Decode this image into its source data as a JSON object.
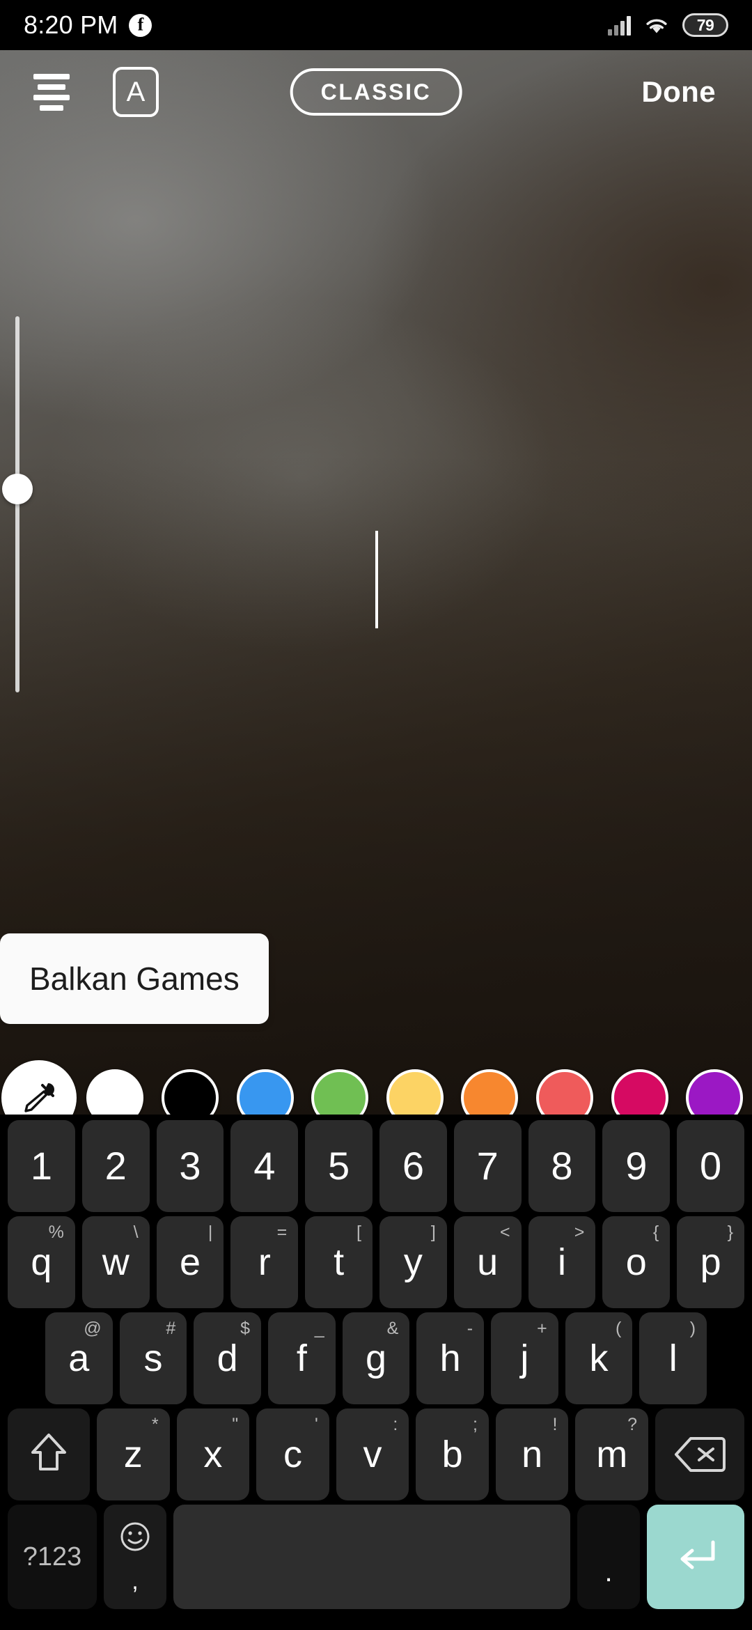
{
  "status_bar": {
    "time": "8:20 PM",
    "app_icon": "facebook-icon",
    "battery_level": "79",
    "signal_icon": "cellular-signal-icon",
    "wifi_icon": "wifi-icon"
  },
  "toolbar": {
    "align_icon": "text-align-center-icon",
    "text_background_label": "A",
    "font_style_label": "CLASSIC",
    "done_label": "Done"
  },
  "editor": {
    "text_value": "Balkan Games",
    "caret": "text-caret",
    "size_slider": "text-size-slider"
  },
  "palette": {
    "swatches": [
      {
        "name": "eyedropper",
        "color": "#ffffff"
      },
      {
        "name": "white",
        "color": "#ffffff"
      },
      {
        "name": "black",
        "color": "#000000"
      },
      {
        "name": "blue",
        "color": "#3897f0"
      },
      {
        "name": "green",
        "color": "#70bf53"
      },
      {
        "name": "yellow",
        "color": "#fcd364"
      },
      {
        "name": "orange",
        "color": "#f7872f"
      },
      {
        "name": "red",
        "color": "#ef5b5b"
      },
      {
        "name": "magenta",
        "color": "#d60a62"
      },
      {
        "name": "purple",
        "color": "#9b18c4"
      }
    ],
    "page_dots": [
      "active",
      "inactive",
      "inactive"
    ]
  },
  "keyboard": {
    "row_numbers": [
      {
        "main": "1",
        "sup": ""
      },
      {
        "main": "2",
        "sup": ""
      },
      {
        "main": "3",
        "sup": ""
      },
      {
        "main": "4",
        "sup": ""
      },
      {
        "main": "5",
        "sup": ""
      },
      {
        "main": "6",
        "sup": ""
      },
      {
        "main": "7",
        "sup": ""
      },
      {
        "main": "8",
        "sup": ""
      },
      {
        "main": "9",
        "sup": ""
      },
      {
        "main": "0",
        "sup": ""
      }
    ],
    "row_top": [
      {
        "main": "q",
        "sup": "%"
      },
      {
        "main": "w",
        "sup": "\\"
      },
      {
        "main": "e",
        "sup": "|"
      },
      {
        "main": "r",
        "sup": "="
      },
      {
        "main": "t",
        "sup": "["
      },
      {
        "main": "y",
        "sup": "]"
      },
      {
        "main": "u",
        "sup": "<"
      },
      {
        "main": "i",
        "sup": ">"
      },
      {
        "main": "o",
        "sup": "{"
      },
      {
        "main": "p",
        "sup": "}"
      }
    ],
    "row_home": [
      {
        "main": "a",
        "sup": "@"
      },
      {
        "main": "s",
        "sup": "#"
      },
      {
        "main": "d",
        "sup": "$"
      },
      {
        "main": "f",
        "sup": "_"
      },
      {
        "main": "g",
        "sup": "&"
      },
      {
        "main": "h",
        "sup": "-"
      },
      {
        "main": "j",
        "sup": "+"
      },
      {
        "main": "k",
        "sup": "("
      },
      {
        "main": "l",
        "sup": ")"
      }
    ],
    "row_bottom": [
      {
        "main": "z",
        "sup": "*"
      },
      {
        "main": "x",
        "sup": "\""
      },
      {
        "main": "c",
        "sup": "'"
      },
      {
        "main": "v",
        "sup": ":"
      },
      {
        "main": "b",
        "sup": ";"
      },
      {
        "main": "n",
        "sup": "!"
      },
      {
        "main": "m",
        "sup": "?"
      }
    ],
    "shift_key": "shift-key",
    "backspace_key": "backspace-key",
    "symbols_label": "?123",
    "emoji_key": "emoji-key",
    "emoji_secondary": ",",
    "space_key": "space-key",
    "period_key": ".",
    "enter_key": "enter-key",
    "enter_color": "#9bd8cf"
  }
}
